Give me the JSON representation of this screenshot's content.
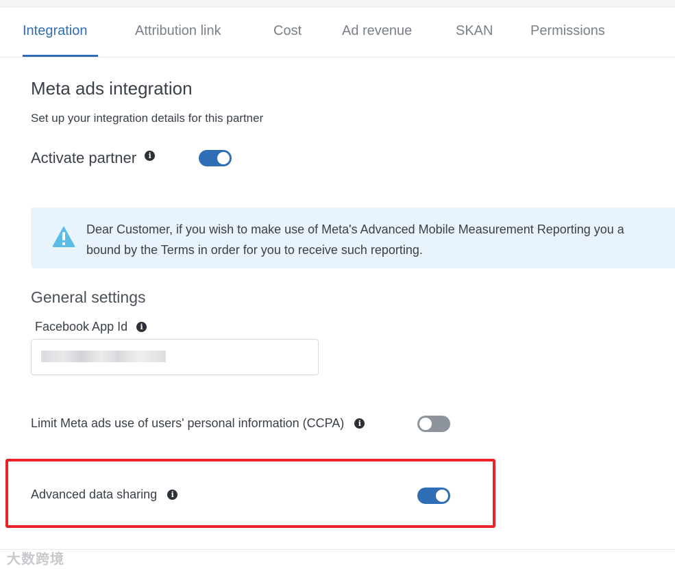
{
  "tabs": [
    {
      "label": "Integration",
      "active": true
    },
    {
      "label": "Attribution link"
    },
    {
      "label": "Cost"
    },
    {
      "label": "Ad revenue"
    },
    {
      "label": "SKAN"
    },
    {
      "label": "Permissions"
    }
  ],
  "page": {
    "title": "Meta ads integration",
    "subtitle": "Set up your integration details for this partner"
  },
  "activate_partner": {
    "label": "Activate partner",
    "enabled": true
  },
  "alert": {
    "icon": "warning-icon",
    "line1": "Dear Customer, if you wish to make use of Meta's Advanced Mobile Measurement Reporting you a",
    "line2": "bound by the Terms in order for you to receive such reporting."
  },
  "general_settings": {
    "title": "General settings",
    "app_id_label": "Facebook App Id"
  },
  "ccpa": {
    "label": "Limit Meta ads use of users' personal information (CCPA)",
    "enabled": false
  },
  "advanced_sharing": {
    "label": "Advanced data sharing",
    "enabled": true
  },
  "colors": {
    "accent": "#2f6db5",
    "highlight": "#e8232a",
    "alert_bg": "#e8f3fb",
    "warning": "#5bbde6"
  },
  "watermark": "大数跨境"
}
